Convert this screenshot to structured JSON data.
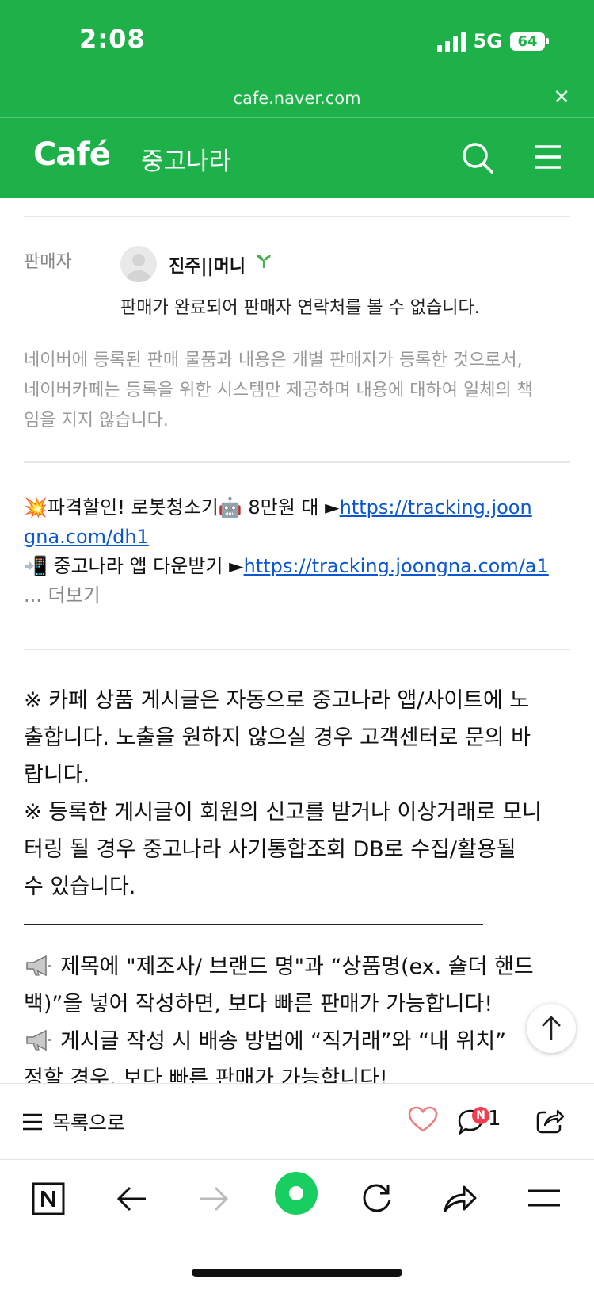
{
  "status_bar": {
    "time": "2:08",
    "network": "5G",
    "battery": "64"
  },
  "browser": {
    "url": "cafe.naver.com"
  },
  "header": {
    "logo": "Café",
    "cafe_name": "중고나라"
  },
  "seller": {
    "label": "판매자",
    "name": "진주||머니",
    "sold_message": "판매가 완료되어 판매자 연락처를 볼 수 없습니다."
  },
  "disclaimer": [
    "네이버에 등록된 판매 물품과 내용은 개별 판매자가 등록한 것으로서,",
    "네이버카페는 등록을 위한 시스템만 제공하며 내용에 대하여 일체의 책",
    "임을 지지 않습니다."
  ],
  "promo": {
    "line1_text": "💥파격할인! 로봇청소기🤖 8만원 대 ►",
    "line1_link": "https://tracking.joon",
    "line2_link": "gna.com/dh1",
    "line3_text": "📲 중고나라 앱 다운받기 ►",
    "line3_link": "https://tracking.joongna.com/a1",
    "more": "... 더보기"
  },
  "notice": [
    "※ 카페 상품 게시글은 자동으로 중고나라 앱/사이트에 노",
    "출합니다. 노출을 원하지 않으실 경우 고객센터로 문의 바",
    "랍니다.",
    "※ 등록한 게시글이 회원의 신고를 받거나 이상거래로 모니",
    "터링 될 경우 중고나라 사기통합조회 DB로 수집/활용될",
    "수 있습니다."
  ],
  "tips": {
    "line1": "제목에 \"제조사/ 브랜드 명\"과 “상품명(ex. 숄더 핸드",
    "line2": "백)”을 넣어 작성하면, 보다 빠른 판매가 가능합니다!",
    "line3": "게시글 작성 시 배송 방법에 “직거래”와 “내 위치”",
    "line4": "정할 경우, 보다 빠른 판매가 가능합니다!"
  },
  "action_bar": {
    "list_label": "목록으로",
    "new_badge": "N",
    "comment_count": "1"
  },
  "colors": {
    "brand_green": "#1eb14a",
    "link": "#0b57d0",
    "heart": "#f07b7b",
    "badge": "#f23d4f",
    "naver_dot": "#19ce60"
  },
  "icons": [
    "search-icon",
    "menu-icon",
    "sprout-icon",
    "megaphone-icon",
    "arrow-up-icon",
    "list-icon",
    "heart-icon",
    "comment-icon",
    "share-icon",
    "naver-n-icon",
    "back-icon",
    "forward-icon",
    "green-dot-icon",
    "refresh-icon",
    "share-arrow-icon",
    "hamburger-icon"
  ]
}
